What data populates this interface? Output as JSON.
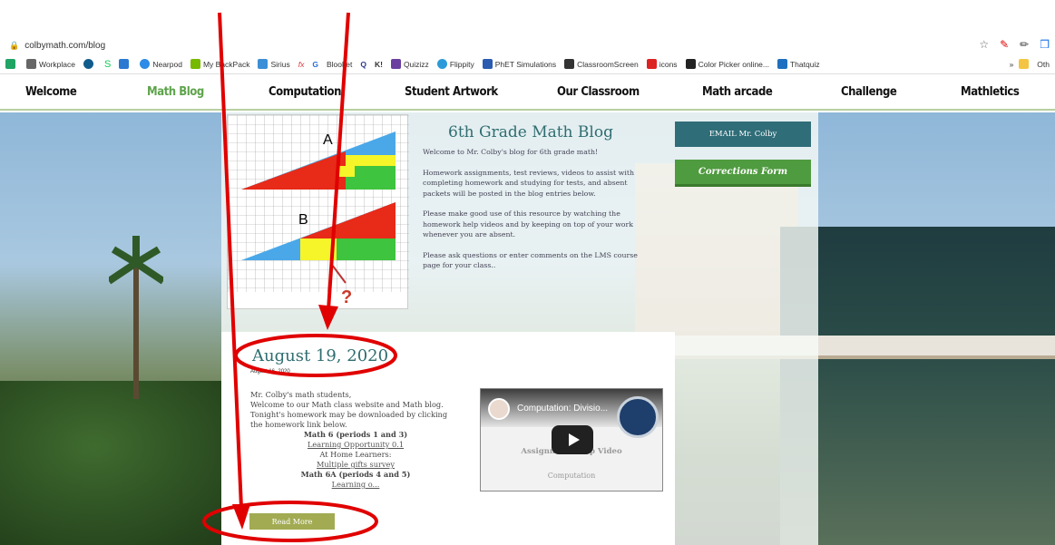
{
  "browser": {
    "url": "colbymath.com/blog",
    "bookmarks": [
      "Workplace",
      "S",
      "Nearpod",
      "My BackPack",
      "Sirius",
      "fx",
      "G",
      "Blooket",
      "Q",
      "K!",
      "Quizizz",
      "Flippity",
      "PhET Simulations",
      "ClassroomScreen",
      "icons",
      "Color Picker online...",
      "Thatquiz"
    ],
    "overflow": "»",
    "other": "Oth"
  },
  "nav": {
    "items": [
      "Welcome",
      "Math Blog",
      "Computation",
      "Student Artwork",
      "Our Classroom",
      "Math arcade",
      "Challenge",
      "Mathletics"
    ],
    "active_color": "#5da34a"
  },
  "header": {
    "title": "6th Grade Math Blog",
    "intro": [
      "Welcome to Mr. Colby's blog for 6th grade math!",
      "Homework assignments, test reviews, videos to assist with completing homework and studying for tests, and absent packets will be posted in the blog entries below.",
      "Please make good use of this resource by watching the homework help videos and by keeping on top of your work whenever you are absent.",
      "Please ask questions or enter comments on the LMS course page for your class.."
    ],
    "email_button": "EMAIL Mr. Colby",
    "corrections_button": "Corrections Form",
    "figure_labels": {
      "a": "A",
      "b": "B",
      "q": "?"
    }
  },
  "post": {
    "title": "August 19, 2020",
    "date": "August 16, 2020",
    "greeting": "Mr. Colby's math students,",
    "line1": "Welcome to our Math class website and Math blog. Tonight's homework may be downloaded by clicking the homework link below.",
    "math6": "Math 6 (periods 1 and 3)",
    "link1": "Learning Opportunity 0.1",
    "athome": "At Home Learners:",
    "link2": "Multiple gifts survey",
    "math6a": "Math 6A (periods 4 and 5)",
    "link3": "Learning o...",
    "read_more": "Read More"
  },
  "video": {
    "title": "Computation: Divisio...",
    "caption1": "Assignment Help Video",
    "caption2": "Computation"
  },
  "colors": {
    "teal": "#2f6d70",
    "green": "#4f9b3f",
    "readmore": "#a2ab52",
    "annotation": "#e00000"
  }
}
